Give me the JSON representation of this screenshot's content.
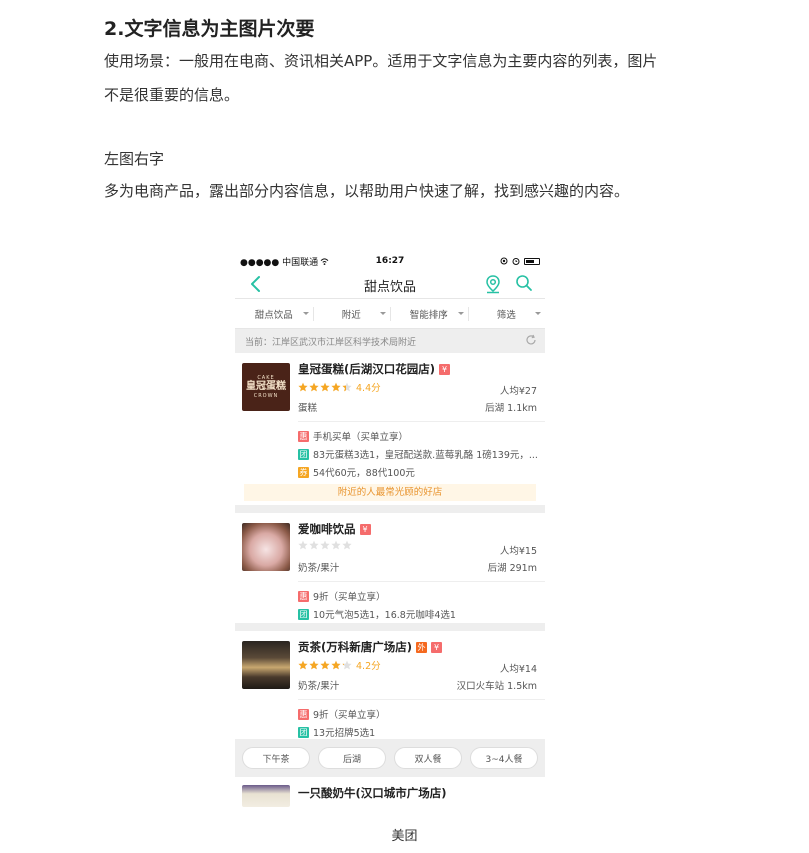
{
  "article": {
    "heading": "2.文字信息为主图片次要",
    "para1_line1": "使用场景：一般用在电商、资讯相关APP。适用于文字信息为主要内容的列表，图片",
    "para1_line2": "不是很重要的信息。",
    "subheading": "左图右字",
    "para2": "多为电商产品，露出部分内容信息，以帮助用户快速了解，找到感兴趣的内容。",
    "caption": "美团"
  },
  "phone": {
    "status": {
      "carrier": "●●●●● 中国联通",
      "time": "16:27"
    },
    "nav": {
      "title": "甜点饮品",
      "back_icon": "chevron-left-icon",
      "location_icon": "map-pin-icon",
      "search_icon": "search-icon"
    },
    "filters": [
      "甜点饮品",
      "附近",
      "智能排序",
      "筛选"
    ],
    "location": "当前：江岸区武汉市江岸区科学技术局附近",
    "colors": {
      "accent": "#27c1a4",
      "star": "#f5a623",
      "hui": "#f56c6c",
      "tuan": "#27c1a4",
      "mai": "#f5a623"
    },
    "shops": [
      {
        "name": "皇冠蛋糕(后湖汉口花园店)",
        "logo_text_top": "CAKE",
        "logo_text_main": "皇冠蛋糕",
        "logo_text_bottom": "CROWN",
        "badges": [
          "¥"
        ],
        "rating": 4.4,
        "score": "4.4分",
        "avg": "人均¥27",
        "category": "蛋糕",
        "distance": "后湖  1.1km",
        "deals": [
          {
            "tag": "惠",
            "text": "手机买单（买单立享）"
          },
          {
            "tag": "团",
            "text": "83元蛋糕3选1，皇冠配送款.蓝莓乳酪 1磅139元，..."
          },
          {
            "tag": "券",
            "text": "54代60元，88代100元"
          }
        ],
        "hot": "附近的人最常光顾的好店"
      },
      {
        "name": "爱咖啡饮品",
        "badges": [
          "¥"
        ],
        "rating": 0,
        "score": "",
        "avg": "人均¥15",
        "category": "奶茶/果汁",
        "distance": "后湖  291m",
        "deals": [
          {
            "tag": "惠",
            "text": "9折（买单立享）"
          },
          {
            "tag": "团",
            "text": "10元气泡5选1，16.8元咖啡4选1"
          }
        ]
      },
      {
        "name": "贡茶(万科新唐广场店)",
        "badges": [
          "外",
          "¥"
        ],
        "rating": 4.2,
        "score": "4.2分",
        "avg": "人均¥14",
        "category": "奶茶/果汁",
        "distance": "汉口火车站  1.5km",
        "deals": [
          {
            "tag": "惠",
            "text": "9折（买单立享）"
          },
          {
            "tag": "团",
            "text": "13元招牌5选1"
          }
        ]
      }
    ],
    "chips": [
      "下午茶",
      "后湖",
      "双人餐",
      "3~4人餐"
    ],
    "partial_shop": "一只酸奶牛(汉口城市广场店)"
  }
}
